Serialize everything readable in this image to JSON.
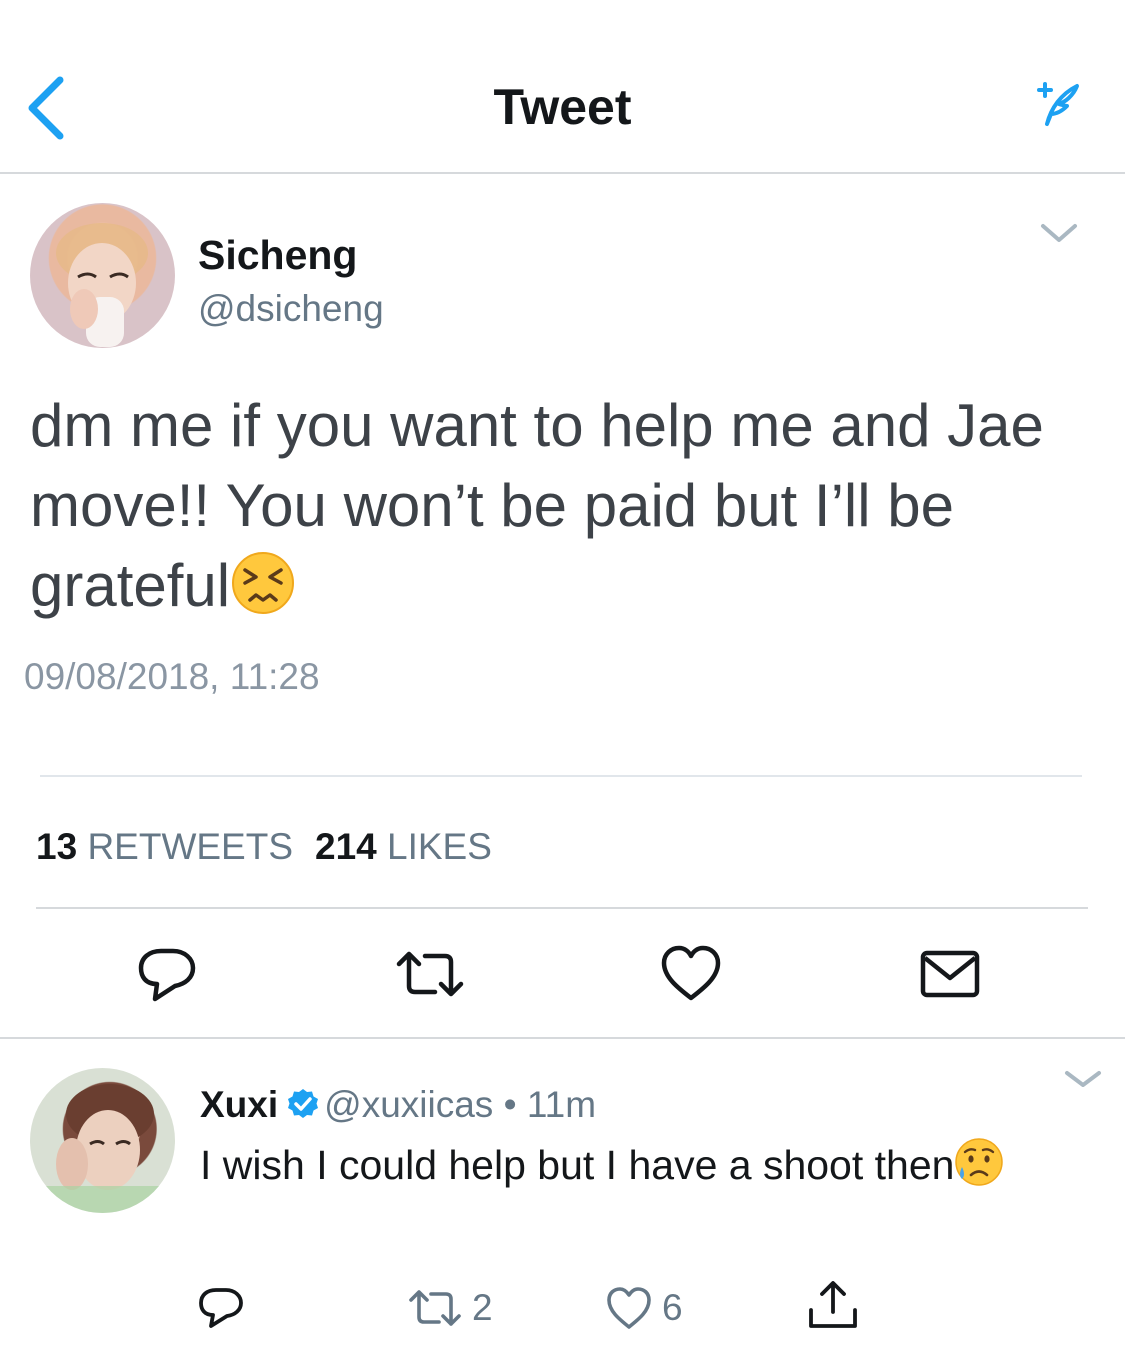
{
  "header": {
    "title": "Tweet",
    "back_icon": "chevron-left-icon",
    "compose_icon": "compose-tweet-icon"
  },
  "tweet": {
    "author_name": "Sicheng",
    "author_handle": "@dsicheng",
    "text": "dm me if you want to help me and Jae move!! You won’t be paid but I’ll be grateful",
    "emoji": "persevering-face",
    "timestamp": "09/08/2018, 11:28",
    "retweets_count": "13",
    "retweets_label": "RETWEETS",
    "likes_count": "214",
    "likes_label": "LIKES"
  },
  "actions": [
    "reply-icon",
    "retweet-icon",
    "like-icon",
    "direct-message-icon"
  ],
  "reply": {
    "author_name": "Xuxi",
    "verified": true,
    "author_handle": "@xuxiicas",
    "separator": "•",
    "time": "11m",
    "text": "I wish I could help but I have a shoot then",
    "emoji": "sad-but-relieved-face",
    "retweet_count": "2",
    "like_count": "6"
  },
  "colors": {
    "accent": "#1da1f2",
    "icon_dark": "#14171a",
    "secondary": "#657786",
    "divider": "#d6d9dc"
  }
}
